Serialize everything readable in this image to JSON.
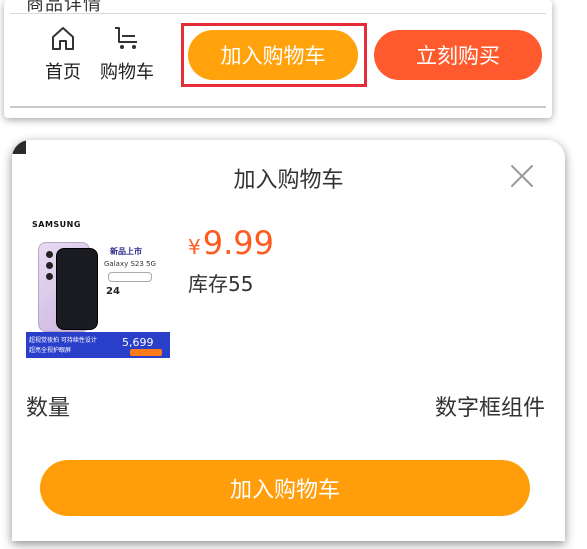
{
  "top_bar": {
    "cut_off_text": "商品详情",
    "nav": {
      "home_label": "首页",
      "cart_label": "购物车"
    },
    "add_to_cart_label": "加入购物车",
    "buy_now_label": "立刻购买",
    "colors": {
      "add_to_cart": "#ffa20b",
      "buy_now": "#ff5a2d",
      "highlight": "#e52d3a"
    }
  },
  "popup": {
    "title": "加入购物车",
    "close_icon": "close-icon",
    "product": {
      "brand": "SAMSUNG",
      "image_new_tag": "新品上市",
      "image_model": "Galaxy S23 5G",
      "image_badge": "24",
      "image_banner_line1": "超视觉夜拍 可持续性设计",
      "image_banner_line2": "超亮全视护眼屏",
      "image_banner_price": "5,699",
      "currency": "¥",
      "price": "9.99",
      "stock": "库存55"
    },
    "quantity_label": "数量",
    "quantity_widget": "数字框组件",
    "add_to_cart_label": "加入购物车",
    "colors": {
      "price": "#ff5a1f",
      "add_to_cart": "#ff9e0a"
    }
  }
}
